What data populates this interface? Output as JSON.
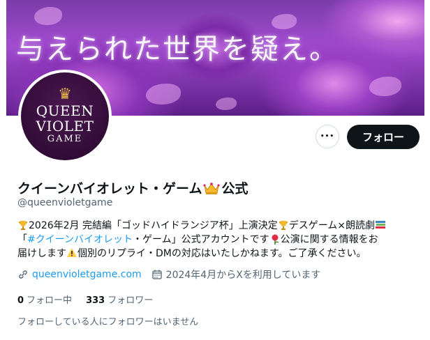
{
  "banner": {
    "text": "与えられた世界を疑え。"
  },
  "avatar": {
    "line1": "QUEEN",
    "line2": "VIOLET",
    "line3": "GAME"
  },
  "actions": {
    "more_label": "•••",
    "follow_label": "フォロー"
  },
  "profile": {
    "name_before": "クイーンバイオレット・ゲーム",
    "name_after": "公式",
    "handle": "@queenvioletgame"
  },
  "bio": {
    "line1_a": "2026年2月 完結編「ゴッドハイドランジア杯」上演決定",
    "line1_b": "デスゲーム×朗読劇",
    "line2_a": "「",
    "line2_link": "#クイーンバイオレット",
    "line2_b": "・ゲーム」公式アカウントです",
    "line2_c": "公演に関する情報をお",
    "line3_a": "届けします",
    "line3_b": "個別のリプライ・DMの対応はいたしかねます。ご了承ください。"
  },
  "meta": {
    "website": "queenvioletgame.com",
    "joined": "2024年4月からXを利用しています"
  },
  "stats": {
    "following_count": "0",
    "following_label": "フォロー中",
    "followers_count": "333",
    "followers_label": "フォロワー"
  },
  "followed_by": "フォローしている人にフォロワーはいません",
  "colors": {
    "accent": "#1d9bf0",
    "follow_bg": "#0f1419",
    "muted": "#536471"
  },
  "icons": [
    "more-icon",
    "link-icon",
    "calendar-icon",
    "crown-icon",
    "trophy-icon",
    "books-icon",
    "rose-icon",
    "warning-icon"
  ]
}
